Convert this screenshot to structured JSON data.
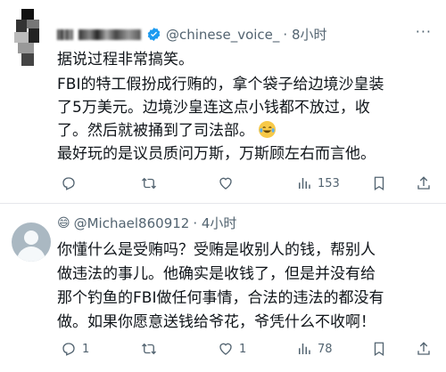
{
  "tweets": [
    {
      "handle": "@chinese_voice_",
      "time": "· 8小时",
      "more": "···",
      "lines": [
        "据说过程非常搞笑。",
        "FBI的特工假扮成行贿的，拿个袋子给边境沙皇装",
        "了5万美元。边境沙皇连这点小钱都不放过，收",
        "了。然后就被捅到了司法部。",
        "最好玩的是议员质问万斯，万斯顾左右而言他。"
      ],
      "emoji_name": "laughing-crying-emoji",
      "actions": {
        "reply": "",
        "retweet": "",
        "like": "",
        "views": "153"
      }
    },
    {
      "emoji_prefix": "😄",
      "handle": "@Michael860912",
      "time": "· 4小时",
      "lines": [
        "你懂什么是受贿吗？受贿是收别人的钱，帮别人",
        "做违法的事儿。他确实是收钱了，但是并没有给",
        "那个钓鱼的FBI做任何事情，合法的违法的都没有",
        "做。如果你愿意送钱给爷花，爷凭什么不收啊！"
      ],
      "actions": {
        "reply": "1",
        "retweet": "",
        "like": "1",
        "views": "78"
      }
    }
  ],
  "colors": {
    "text": "#0f1419",
    "muted": "#536471",
    "verified": "#1d9bf0",
    "divider": "#e5e7eb"
  }
}
